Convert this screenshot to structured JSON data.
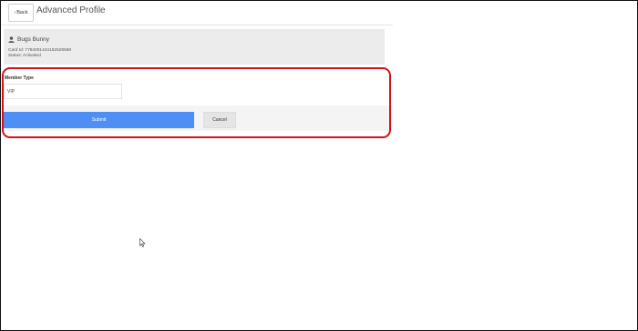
{
  "header": {
    "back_label": "Back",
    "title": "Advanced Profile"
  },
  "profile": {
    "icon": "user-icon",
    "name": "Bugs Bunny",
    "card_id": "Card Id: 7784001444152528568",
    "status": "Status: Activated"
  },
  "form": {
    "member_type_label": "Member Type",
    "member_type_value": "VIP"
  },
  "actions": {
    "submit_label": "Submit",
    "cancel_label": "Cancel"
  },
  "colors": {
    "submit": "#4f8ff5",
    "highlight": "#d1131b"
  }
}
